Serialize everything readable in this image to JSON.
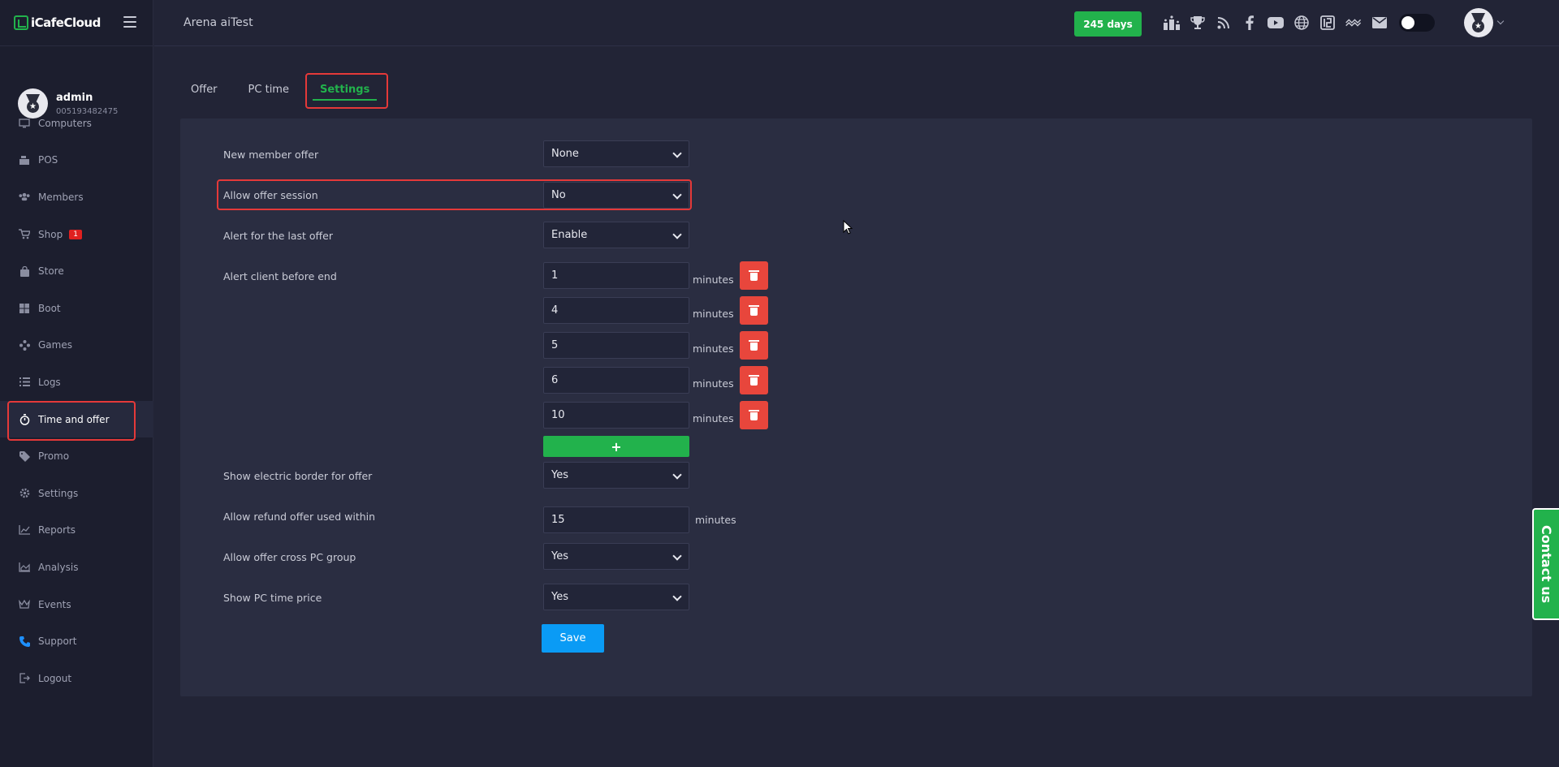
{
  "brand": {
    "name": "iCafeCloud"
  },
  "profile": {
    "name": "admin",
    "id": "005193482475"
  },
  "sidebar": {
    "items": [
      {
        "label": "Computers",
        "icon": "monitor-icon"
      },
      {
        "label": "POS",
        "icon": "cash-register-icon"
      },
      {
        "label": "Members",
        "icon": "members-icon"
      },
      {
        "label": "Shop",
        "icon": "cart-icon",
        "badge": "1"
      },
      {
        "label": "Store",
        "icon": "bag-icon"
      },
      {
        "label": "Boot",
        "icon": "windows-icon"
      },
      {
        "label": "Games",
        "icon": "gamepad-icon"
      },
      {
        "label": "Logs",
        "icon": "list-icon"
      },
      {
        "label": "Time and offer",
        "icon": "stopwatch-icon",
        "active": true
      },
      {
        "label": "Promo",
        "icon": "tag-icon"
      },
      {
        "label": "Settings",
        "icon": "gear-icon"
      },
      {
        "label": "Reports",
        "icon": "line-chart-icon"
      },
      {
        "label": "Analysis",
        "icon": "area-chart-icon"
      },
      {
        "label": "Events",
        "icon": "crown-icon"
      },
      {
        "label": "Support",
        "icon": "phone-icon"
      },
      {
        "label": "Logout",
        "icon": "logout-icon"
      }
    ]
  },
  "topbar": {
    "title": "Arena aiTest",
    "days_badge": "245 days",
    "icons": [
      "ranking-icon",
      "trophy-icon",
      "rss-icon",
      "facebook-icon",
      "youtube-icon",
      "globe-icon",
      "icafe-icon",
      "wave-icon",
      "mail-icon"
    ]
  },
  "tabs": [
    {
      "label": "Offer"
    },
    {
      "label": "PC time"
    },
    {
      "label": "Settings",
      "active": true
    }
  ],
  "form": {
    "new_member_offer": {
      "label": "New member offer",
      "value": "None"
    },
    "allow_offer_session": {
      "label": "Allow offer session",
      "value": "No"
    },
    "alert_last_offer": {
      "label": "Alert for the last offer",
      "value": "Enable"
    },
    "alert_before_end": {
      "label": "Alert client before end",
      "unit": "minutes",
      "values": [
        "1",
        "4",
        "5",
        "6",
        "10"
      ]
    },
    "electric_border": {
      "label": "Show electric border for offer",
      "value": "Yes"
    },
    "refund_within": {
      "label": "Allow refund offer used within",
      "value": "15",
      "unit": "minutes"
    },
    "cross_pc_group": {
      "label": "Allow offer cross PC group",
      "value": "Yes"
    },
    "show_pc_time_price": {
      "label": "Show PC time price",
      "value": "Yes"
    },
    "add_label": "+",
    "save_label": "Save"
  },
  "contact": {
    "label": "Contact us"
  },
  "colors": {
    "accent_green": "#22b24c",
    "highlight_red": "#e53939",
    "delete_red": "#e8463c",
    "save_blue": "#0a9bf5",
    "bg": "#222436",
    "panel": "#2a2d41"
  }
}
